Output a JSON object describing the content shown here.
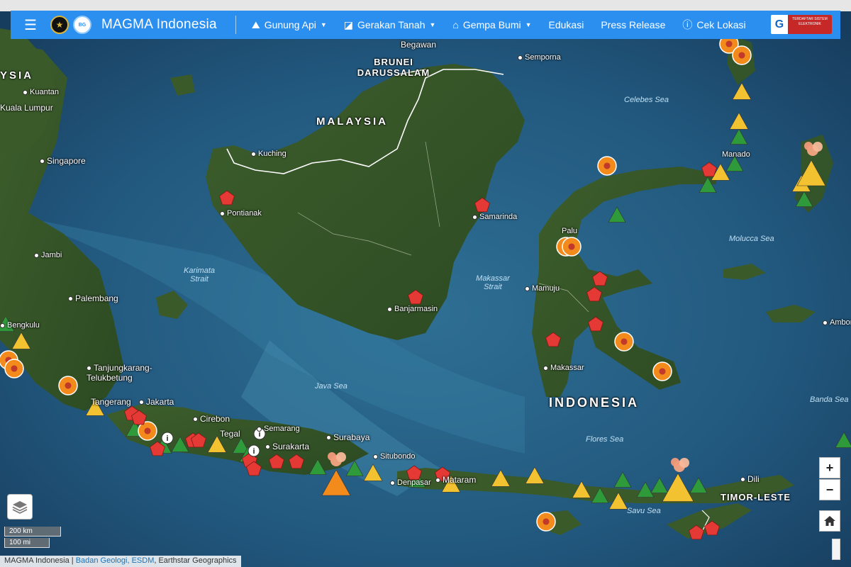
{
  "navbar": {
    "brand": "MAGMA Indonesia",
    "menu_icon": "hamburger-icon",
    "items": [
      {
        "label": "Gunung Api",
        "icon": "volcano-icon",
        "dropdown": true
      },
      {
        "label": "Gerakan Tanah",
        "icon": "landslide-icon",
        "dropdown": true
      },
      {
        "label": "Gempa Bumi",
        "icon": "earthquake-icon",
        "dropdown": true
      },
      {
        "label": "Edukasi",
        "dropdown": false
      },
      {
        "label": "Press Release",
        "dropdown": false
      },
      {
        "label": "Cek Lokasi",
        "icon": "info-icon",
        "dropdown": false
      }
    ],
    "badge_text": "TERDAFTAR SISTEM ELEKTRONIK",
    "accent": "#2b8ff0"
  },
  "map": {
    "countries": [
      "MALAYSIA",
      "BRUNEI DARUSSALAM",
      "INDONESIA",
      "TIMOR-LESTE",
      "YSIA"
    ],
    "cities": [
      "Bandar Seri Begawan",
      "Kuantan",
      "Kuala Lumpur",
      "Singapore",
      "Kuching",
      "Pontianak",
      "Jambi",
      "Palembang",
      "Bengkulu",
      "Tanjungkarang-Telukbetung",
      "Jakarta",
      "Tangerang",
      "Cirebon",
      "Tegal",
      "Semarang",
      "Surakarta",
      "Surabaya",
      "Situbondo",
      "Denpasar",
      "Mataram",
      "Banjarmasin",
      "Samarinda",
      "Palu",
      "Mamuju",
      "Makassar",
      "Manado",
      "Semporna",
      "Dili",
      "Ambon"
    ],
    "seas": [
      "Celebes Sea",
      "Molucca Sea",
      "Makassar Strait",
      "Karimata Strait",
      "Java Sea",
      "Flores Sea",
      "Savu Sea",
      "Banda Sea"
    ],
    "legend": {
      "normal": "#2e9a3a",
      "waspada": "#f2c230",
      "siaga": "#f28a1c",
      "awas": "#e53935",
      "landslide": "#e53935"
    }
  },
  "controls": {
    "zoom_in": "+",
    "zoom_out": "−",
    "home_icon": "home-icon",
    "layers_icon": "layers-icon"
  },
  "scale": {
    "km": "200 km",
    "mi": "100 mi"
  },
  "attribution": {
    "prefix": "MAGMA Indonesia |",
    "links": "Badan Geologi, ESDM",
    "suffix": ", Earthstar Geographics"
  }
}
